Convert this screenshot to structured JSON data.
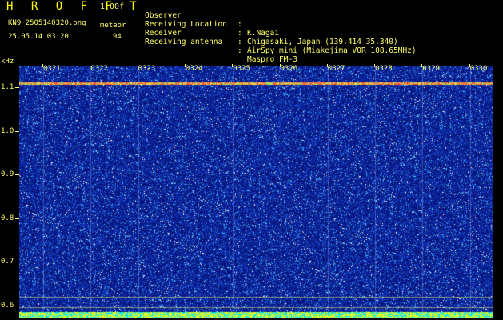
{
  "header": {
    "app_title": "H R O F F T",
    "version": "1.00f",
    "filename": "KN9_2505140320.png",
    "datetime": "25.05.14 03:20",
    "meteor_label": "meteor",
    "meteor_count": "94"
  },
  "info": [
    {
      "key": "Observer",
      "sep": ":",
      "value": "K.Nagai"
    },
    {
      "key": "Receiving Location",
      "sep": ":",
      "value": "Chigasaki, Japan (139.414 35.340)"
    },
    {
      "key": "Receiver",
      "sep": ":",
      "value": "AirSpy mini (Miakejima VOR 108.65MHz)"
    },
    {
      "key": "Receiving antenna",
      "sep": ":",
      "value": "Maspro FM-3"
    }
  ],
  "y_axis": {
    "unit": "kHz",
    "ticks": [
      "1.1",
      "1.0",
      "0.9",
      "0.8",
      "0.7",
      "0.6"
    ],
    "range": [
      0.57,
      1.15
    ]
  },
  "x_axis": {
    "ticks": [
      "0321",
      "0322",
      "0323",
      "0324",
      "0325",
      "0326",
      "0327",
      "0328",
      "0329",
      "0330"
    ]
  },
  "colors": {
    "background": "#000000",
    "spectrogram_base": "#0a1d8c",
    "text": "#ffff66",
    "signal_line": "#ff4040",
    "bottom_band": "#ffff00"
  }
}
